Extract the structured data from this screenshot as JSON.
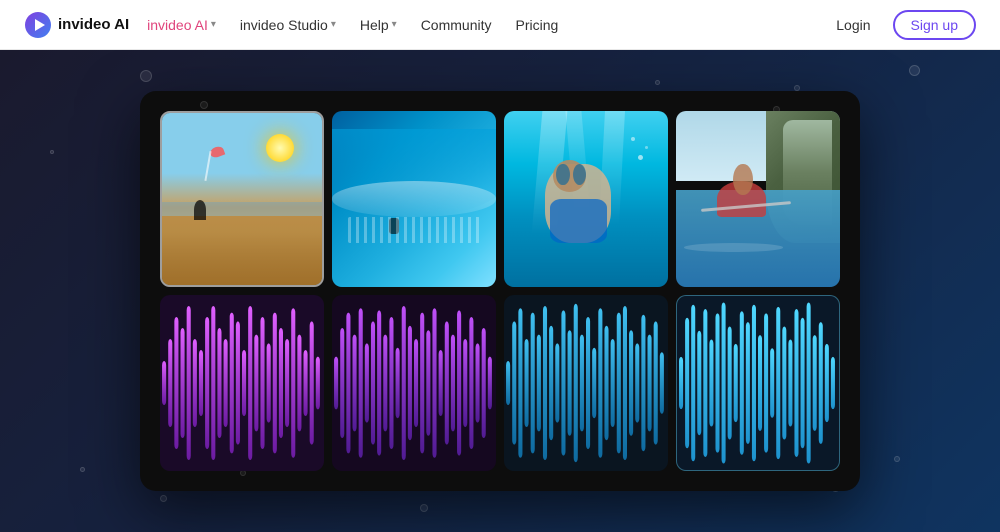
{
  "navbar": {
    "logo_text": "invideo AI",
    "nav_items": [
      {
        "label": "invideo AI",
        "active": true,
        "has_dropdown": true
      },
      {
        "label": "invideo Studio",
        "active": false,
        "has_dropdown": true
      },
      {
        "label": "Help",
        "active": false,
        "has_dropdown": true
      },
      {
        "label": "Community",
        "active": false,
        "has_dropdown": false
      },
      {
        "label": "Pricing",
        "active": false,
        "has_dropdown": false
      }
    ],
    "login_label": "Login",
    "signup_label": "Sign up"
  },
  "main": {
    "clips": [
      {
        "id": "clip-1",
        "theme": "kitesurf"
      },
      {
        "id": "clip-2",
        "theme": "wave"
      },
      {
        "id": "clip-3",
        "theme": "underwater"
      },
      {
        "id": "clip-4",
        "theme": "kayak"
      }
    ],
    "audio_clips": [
      {
        "id": "audio-1",
        "color_primary": "#d060e0",
        "color_secondary": "#a030c0"
      },
      {
        "id": "audio-2",
        "color_primary": "#b060e0",
        "color_secondary": "#8040d0"
      },
      {
        "id": "audio-3",
        "color_primary": "#40a0e8",
        "color_secondary": "#2080d0"
      },
      {
        "id": "audio-4",
        "color_primary": "#40c0e8",
        "color_secondary": "#20a0d0"
      }
    ]
  }
}
